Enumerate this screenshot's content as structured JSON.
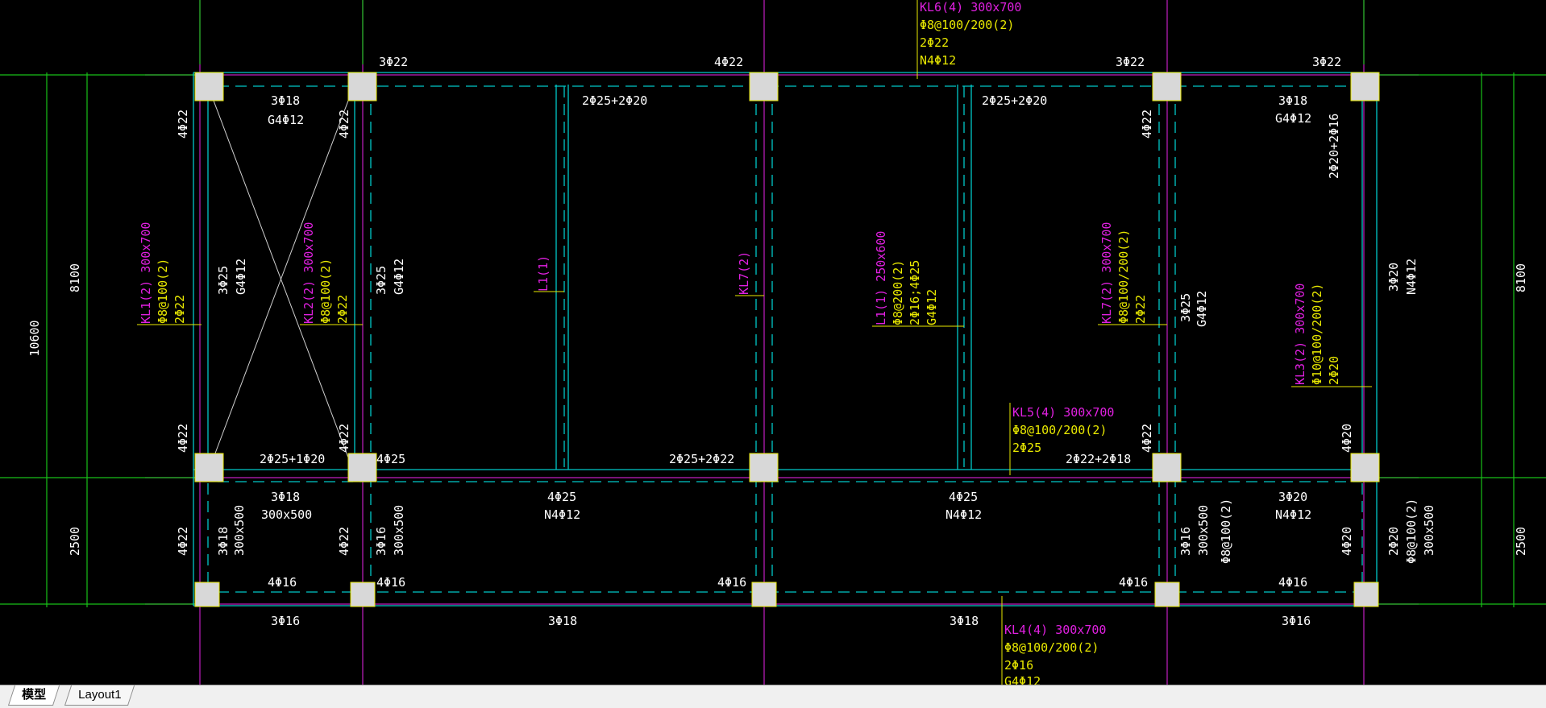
{
  "tabs": [
    {
      "label": "模型",
      "active": true
    },
    {
      "label": "Layout1",
      "active": false
    }
  ],
  "colors": {
    "background": "#000000",
    "grid_axis": "#c01fc0",
    "dimension": "#18c018",
    "beam": "#00c8c8",
    "column_fill": "#d8d8d8",
    "label_white": "#ffffff",
    "label_yellow": "#e8e800",
    "label_magenta": "#e020e0"
  },
  "dimensions": {
    "left_total": "10600",
    "left_upper": "8100",
    "left_lower": "2500",
    "right_upper": "8100",
    "right_lower": "2500"
  },
  "callouts": {
    "kl6": {
      "name": "KL6(4) 300x700",
      "stirrup": "Φ8@100/200(2)",
      "top": "2Φ22",
      "side": "N4Φ12"
    },
    "kl5": {
      "name": "KL5(4) 300x700",
      "stirrup": "Φ8@100/200(2)",
      "top": "2Φ25"
    },
    "kl4": {
      "name": "KL4(4) 300x700",
      "stirrup": "Φ8@100/200(2)",
      "top": "2Φ16",
      "side": "G4Φ12"
    },
    "kl1": {
      "name": "KL1(2) 300x700",
      "stirrup": "Φ8@100(2)",
      "top": "2Φ22"
    },
    "kl2": {
      "name": "KL2(2) 300x700",
      "stirrup": "Φ8@100(2)",
      "top": "2Φ22"
    },
    "kl7": {
      "name": "KL7(2) 300x700",
      "stirrup": "Φ8@100/200(2)",
      "top": "2Φ22"
    },
    "kl3": {
      "name": "KL3(2) 300x700",
      "stirrup": "Φ10@100/200(2)",
      "top": "2Φ20"
    },
    "l1a": {
      "name": "L1(1)"
    },
    "l1b": {
      "name": "L1(1) 250x600",
      "stirrup": "Φ8@200(2)",
      "top": "2Φ16;4Φ25",
      "side": "G4Φ12"
    },
    "kl7b": {
      "name": "KL7(2)"
    }
  },
  "rebar_labels": {
    "t1": "3Φ22",
    "t2": "4Φ22",
    "t3": "3Φ22",
    "t4": "3Φ22",
    "t5": "3Φ18",
    "t6": "G4Φ12",
    "t7": "2Φ25+2Φ20",
    "t8": "2Φ25+2Φ20",
    "t9": "3Φ18",
    "t10": "G4Φ12",
    "m1": "2Φ25+1Φ20",
    "m2": "4Φ25",
    "m3": "2Φ25+2Φ22",
    "m4": "2Φ22+2Φ18",
    "m5": "3Φ18",
    "m6": "300x500",
    "m7": "4Φ25",
    "m8": "N4Φ12",
    "m9": "4Φ25",
    "m10": "N4Φ12",
    "m11": "3Φ20",
    "m12": "N4Φ12",
    "b1": "4Φ16",
    "b2": "4Φ16",
    "b3": "4Φ16",
    "b4": "4Φ16",
    "b5": "4Φ16",
    "bb1": "3Φ16",
    "bb2": "3Φ18",
    "bb3": "3Φ18",
    "bb4": "3Φ16",
    "v1": "4Φ22",
    "v2": "4Φ22",
    "v3": "4Φ22",
    "v4": "4Φ22",
    "v5": "4Φ22",
    "v6": "4Φ20",
    "v7": "4Φ22",
    "v8": "4Φ22",
    "v9": "4Φ22",
    "v10": "4Φ20",
    "v11": "2Φ20+2Φ16",
    "v12": "3Φ25",
    "v13": "G4Φ12",
    "v14": "3Φ25",
    "v15": "G4Φ12",
    "v16": "3Φ25",
    "v17": "G4Φ12",
    "v18": "3Φ20",
    "v19": "N4Φ12",
    "w1": "3Φ18",
    "w2": "300x500",
    "w3": "3Φ16",
    "w4": "300x500",
    "w5": "3Φ16",
    "w6": "300x500",
    "w7": "Φ8@100(2)",
    "w8": "2Φ20",
    "w9": "Φ8@100(2)",
    "w10": "300x500"
  }
}
